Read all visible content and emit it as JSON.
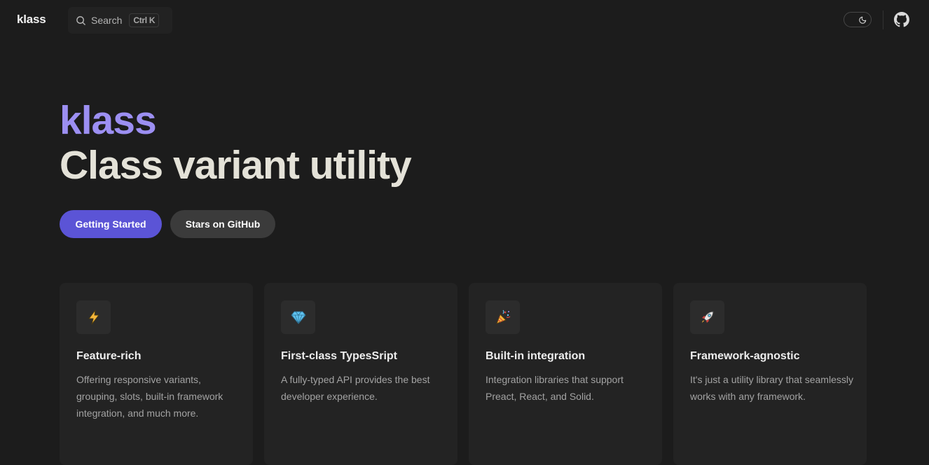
{
  "header": {
    "logo": "klass",
    "search": {
      "label": "Search",
      "shortcut": "Ctrl K"
    },
    "theme_toggle": {
      "icon": "moon-icon"
    },
    "github": {
      "icon": "github-icon"
    }
  },
  "hero": {
    "brand": "klass",
    "title": "Class variant utility",
    "primary_button": "Getting Started",
    "secondary_button": "Stars on GitHub"
  },
  "colors": {
    "background": "#1c1c1c",
    "brand": "#9c8ff2",
    "primary_button": "#5b54d6",
    "card": "#232323"
  },
  "features": [
    {
      "icon": "lightning-icon",
      "emoji": "⚡",
      "title": "Feature-rich",
      "description": "Offering responsive variants, grouping, slots, built-in framework integration, and much more."
    },
    {
      "icon": "gem-icon",
      "emoji": "💎",
      "title": "First-class TypesSript",
      "description": "A fully-typed API provides the best developer experience."
    },
    {
      "icon": "party-popper-icon",
      "emoji": "🎉",
      "title": "Built-in integration",
      "description": "Integration libraries that support Preact, React, and Solid."
    },
    {
      "icon": "rocket-icon",
      "emoji": "🚀",
      "title": "Framework-agnostic",
      "description": "It's just a utility library that seamlessly works with any framework."
    }
  ]
}
